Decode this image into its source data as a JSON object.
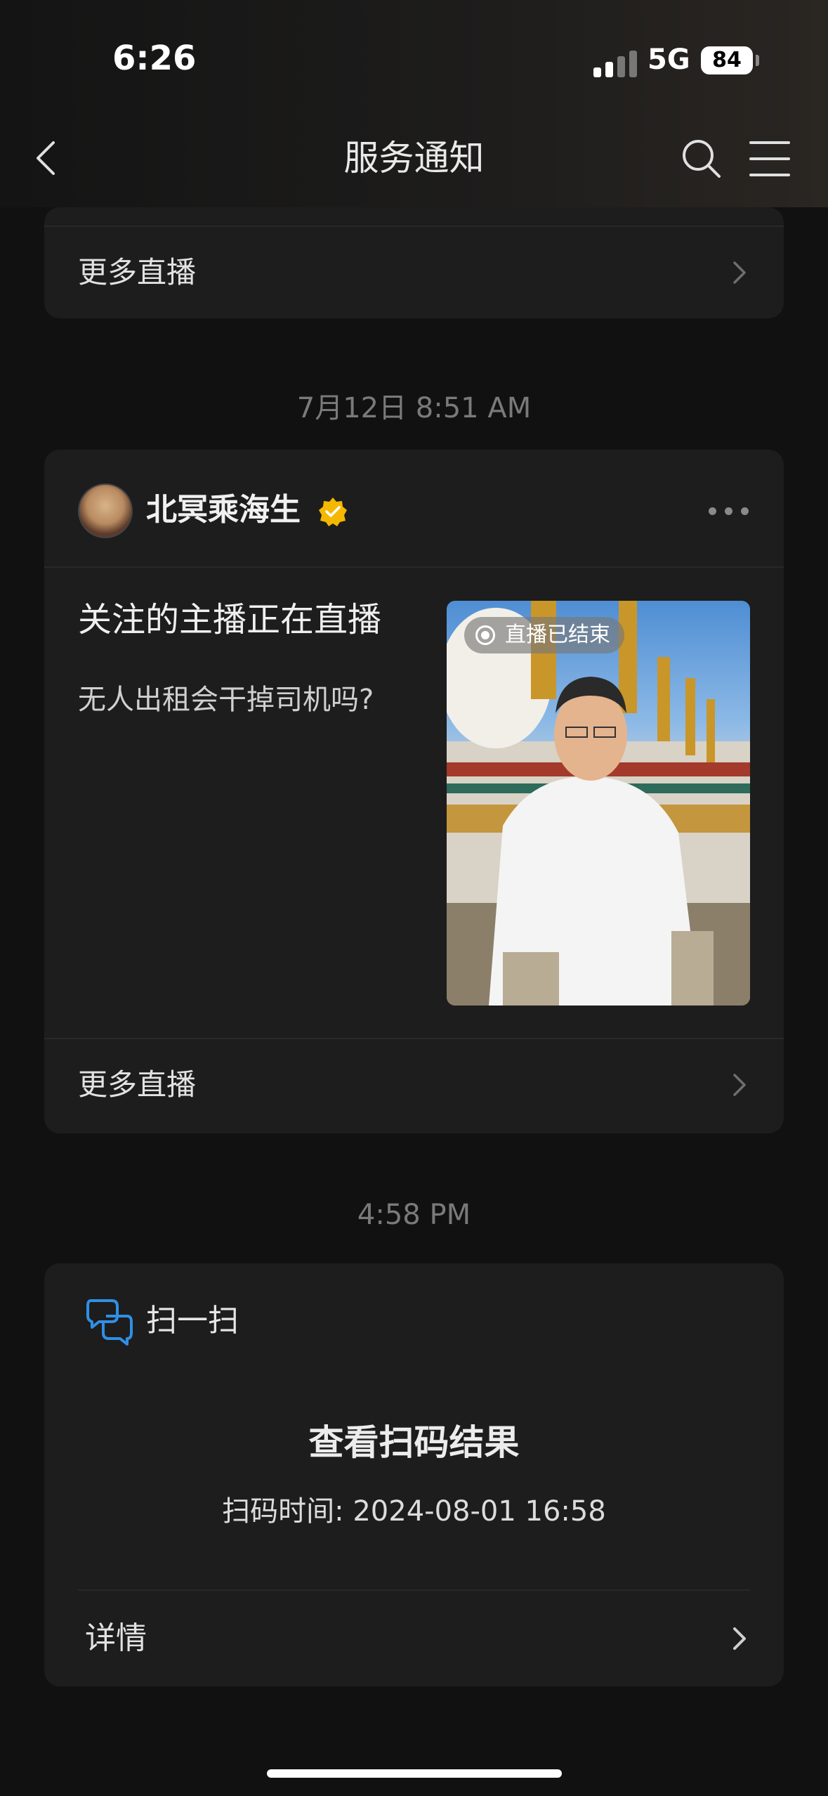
{
  "status_bar": {
    "time": "6:26",
    "network": "5G",
    "battery": "84"
  },
  "navbar": {
    "title": "服务通知",
    "back_icon": "chevron-left-icon",
    "search_icon": "search-icon",
    "menu_icon": "menu-icon"
  },
  "card_top": {
    "more_link": "更多直播"
  },
  "timestamp_1": "7月12日 8:51 AM",
  "live_card": {
    "author": "北冥乘海生",
    "verified": true,
    "title": "关注的主播正在直播",
    "description": "无人出租会干掉司机吗?",
    "thumbnail_badge": "直播已结束",
    "more_link": "更多直播"
  },
  "timestamp_2": "4:58 PM",
  "scan_card": {
    "app_name": "扫一扫",
    "title": "查看扫码结果",
    "scan_time": "扫码时间: 2024-08-01 16:58",
    "details_link": "详情"
  },
  "colors": {
    "background": "#111111",
    "card": "#1d1d1d",
    "verified_badge": "#f5b800",
    "scan_icon": "#2f8fe6"
  }
}
